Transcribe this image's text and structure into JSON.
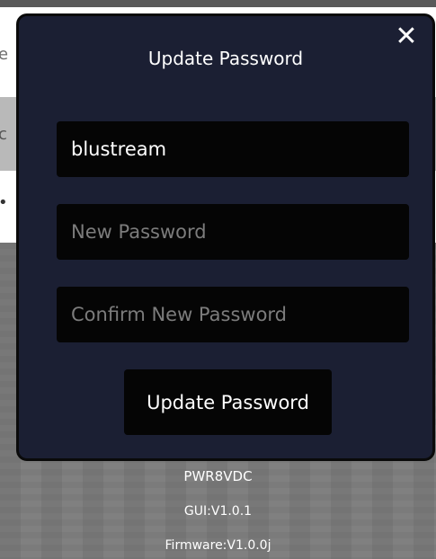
{
  "modal": {
    "title": "Update Password",
    "close_symbol": "✕",
    "username_value": "blustream",
    "new_password_placeholder": "New Password",
    "confirm_password_placeholder": "Confirm New Password",
    "submit_label": "Update Password"
  },
  "device_info": {
    "model": "PWR8VDC",
    "gui_version": "GUI:V1.0.1",
    "firmware_version": "Firmware:V1.0.0j"
  },
  "background": {
    "partial_chars": [
      "e",
      "c",
      "•"
    ]
  },
  "colors": {
    "modal_bg": "#1b1f33",
    "field_bg": "#050505",
    "placeholder": "#7c7c7c",
    "page_gray": "#7b7b7b"
  },
  "icons": {
    "close": "close-icon"
  }
}
